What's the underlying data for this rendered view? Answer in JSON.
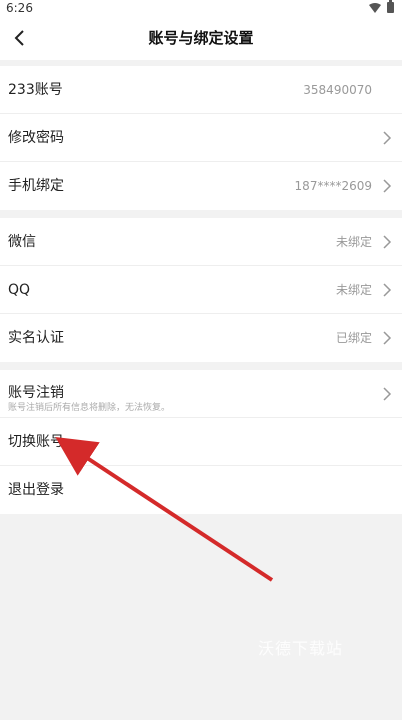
{
  "status": {
    "time": "6:26"
  },
  "header": {
    "title": "账号与绑定设置"
  },
  "account": {
    "id_label": "233账号",
    "id_value": "358490070",
    "password_label": "修改密码",
    "phone_label": "手机绑定",
    "phone_value": "187****2609"
  },
  "bindings": {
    "wechat_label": "微信",
    "wechat_value": "未绑定",
    "qq_label": "QQ",
    "qq_value": "未绑定",
    "realname_label": "实名认证",
    "realname_value": "已绑定"
  },
  "manage": {
    "cancel_label": "账号注销",
    "cancel_sub": "账号注销后所有信息将删除，无法恢复。",
    "switch_label": "切换账号",
    "logout_label": "退出登录"
  },
  "watermark": "沃德下载站"
}
